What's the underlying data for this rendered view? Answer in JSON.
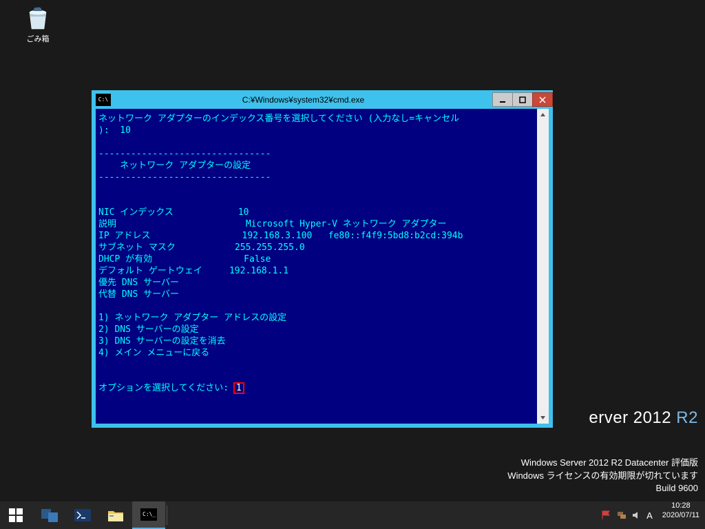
{
  "desktop": {
    "recycle_bin_label": "ごみ箱"
  },
  "watermark": {
    "brand_prefix": "erver 2012",
    "brand_suffix": " R2",
    "line1": "Windows Server 2012 R2 Datacenter 評価版",
    "line2": "Windows ライセンスの有効期限が切れています",
    "line3": "Build 9600"
  },
  "window": {
    "title": "C:¥Windows¥system32¥cmd.exe"
  },
  "terminal": {
    "line01": "ネットワーク アダプターのインデックス番号を選択してください (入力なし=キャンセル",
    "line02": "):  10",
    "line03": "",
    "line04": "--------------------------------",
    "line05": "    ネットワーク アダプターの設定",
    "line06": "--------------------------------",
    "line07": "",
    "line08": "",
    "line09": "NIC インデックス            10",
    "line10": "説明                        Microsoft Hyper-V ネットワーク アダプター",
    "line11": "IP アドレス                 192.168.3.100   fe80::f4f9:5bd8:b2cd:394b",
    "line12": "サブネット マスク           255.255.255.0",
    "line13": "DHCP が有効                 False",
    "line14": "デフォルト ゲートウェイ     192.168.1.1",
    "line15": "優先 DNS サーバー",
    "line16": "代替 DNS サーバー",
    "line17": "",
    "line18": "1) ネットワーク アダプター アドレスの設定",
    "line19": "2) DNS サーバーの設定",
    "line20": "3) DNS サーバーの設定を消去",
    "line21": "4) メイン メニューに戻る",
    "line22": "",
    "line23": "",
    "prompt": "オプションを選択してください: ",
    "input": "1"
  },
  "clock": {
    "time": "10:28",
    "date": "2020/07/11"
  },
  "tray": {
    "ime": "A"
  }
}
